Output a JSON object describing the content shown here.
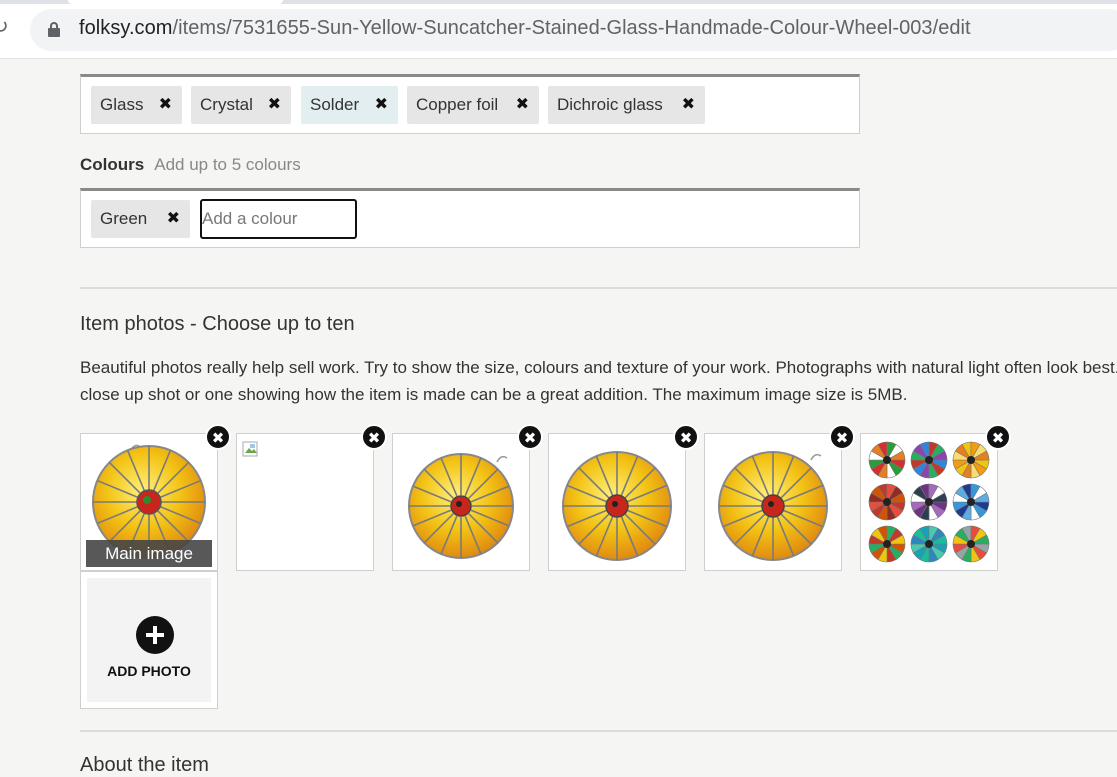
{
  "browser": {
    "url_host": "folksy.com",
    "url_path": "/items/7531655-Sun-Yellow-Suncatcher-Stained-Glass-Handmade-Colour-Wheel-003/edit"
  },
  "materials": {
    "tags": [
      {
        "label": "Glass",
        "remove": "✖"
      },
      {
        "label": "Crystal",
        "remove": "✖"
      },
      {
        "label": "Solder",
        "remove": "✖"
      },
      {
        "label": "Copper foil",
        "remove": "✖"
      },
      {
        "label": "Dichroic glass",
        "remove": "✖"
      }
    ]
  },
  "colours": {
    "label": "Colours",
    "hint": "Add up to 5 colours",
    "tags": [
      {
        "label": "Green",
        "remove": "✖"
      }
    ],
    "input_placeholder": "Add a colour",
    "input_value": ""
  },
  "photos": {
    "title": "Item photos - Choose up to ten",
    "description": "Beautiful photos really help sell work. Try to show the size, colours and texture of your work. Photographs with natural light often look best. A close up shot or one showing how the item is made can be a great addition. The maximum image size is 5MB.",
    "main_badge": "Main image",
    "remove_symbol": "✖",
    "items": [
      {
        "kind": "yellow-suncatcher",
        "main": true
      },
      {
        "kind": "broken-image"
      },
      {
        "kind": "yellow-suncatcher"
      },
      {
        "kind": "yellow-suncatcher"
      },
      {
        "kind": "yellow-suncatcher"
      },
      {
        "kind": "colour-wheel-grid"
      }
    ],
    "add_label": "ADD PHOTO"
  },
  "next_section": {
    "title": "About the item"
  },
  "colors": {
    "accent_dark": "#111111",
    "page_bg": "#f5f5f3",
    "tag_bg": "#e6e6e6",
    "tag_highlight": "#e3eef0"
  }
}
